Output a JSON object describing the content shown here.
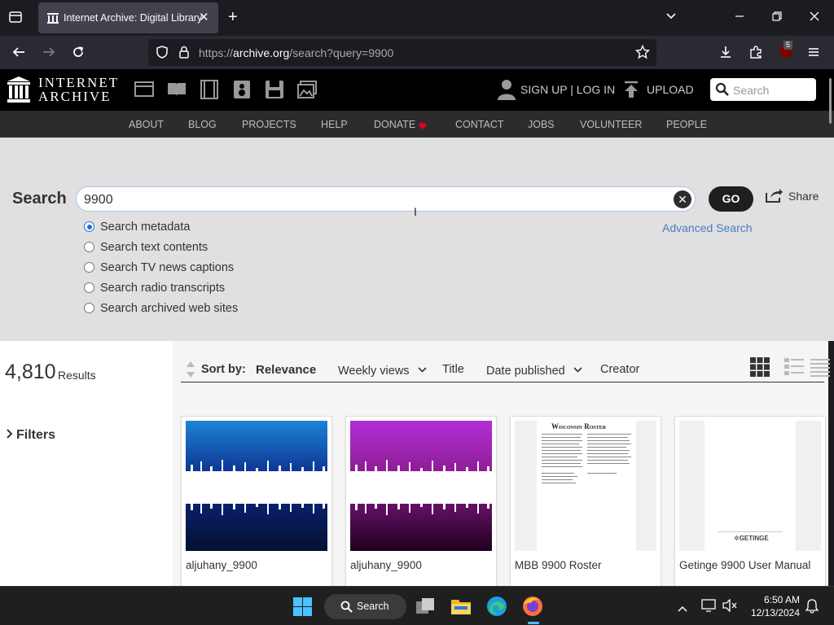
{
  "browser": {
    "tab_title": "Internet Archive: Digital Library",
    "url_prefix": "https://",
    "url_host": "archive.org",
    "url_path": "/search?query=9900",
    "extension_badge": "5"
  },
  "ia_header": {
    "logo_line1": "INTERNET",
    "logo_line2": "ARCHIVE",
    "signin": "SIGN UP | LOG IN",
    "upload": "UPLOAD",
    "search_placeholder": "Search"
  },
  "ia_nav": [
    "ABOUT",
    "BLOG",
    "PROJECTS",
    "HELP",
    "DONATE",
    "CONTACT",
    "JOBS",
    "VOLUNTEER",
    "PEOPLE"
  ],
  "search": {
    "label": "Search",
    "query": "9900",
    "go_label": "GO",
    "share_label": "Share",
    "advanced_label": "Advanced Search",
    "options": [
      {
        "label": "Search metadata",
        "checked": true
      },
      {
        "label": "Search text contents",
        "checked": false
      },
      {
        "label": "Search TV news captions",
        "checked": false
      },
      {
        "label": "Search radio transcripts",
        "checked": false
      },
      {
        "label": "Search archived web sites",
        "checked": false
      }
    ]
  },
  "results": {
    "count": "4,810",
    "count_label": "Results",
    "filters_label": "Filters",
    "sort_label": "Sort by:",
    "sort_options": [
      "Relevance",
      "Weekly views",
      "Title",
      "Date published",
      "Creator"
    ],
    "items": [
      {
        "title": "aljuhany_9900",
        "thumb": "audio-blue"
      },
      {
        "title": "aljuhany_9900",
        "thumb": "audio-magenta"
      },
      {
        "title": "MBB 9900 Roster",
        "thumb": "doc-roster",
        "doc_heading": "Wisconsin Roster"
      },
      {
        "title": "Getinge 9900 User Manual",
        "thumb": "doc-manual",
        "doc_brand": "GETINGE"
      }
    ]
  },
  "taskbar": {
    "search_label": "Search",
    "time": "6:50 AM",
    "date": "12/13/2024"
  },
  "colors": {
    "ia_black": "#000000",
    "ia_nav_bg": "#2c2c2c",
    "search_bg": "#e0e0e0",
    "link_blue": "#4b7cc6",
    "donate_dot": "#e5001a"
  }
}
